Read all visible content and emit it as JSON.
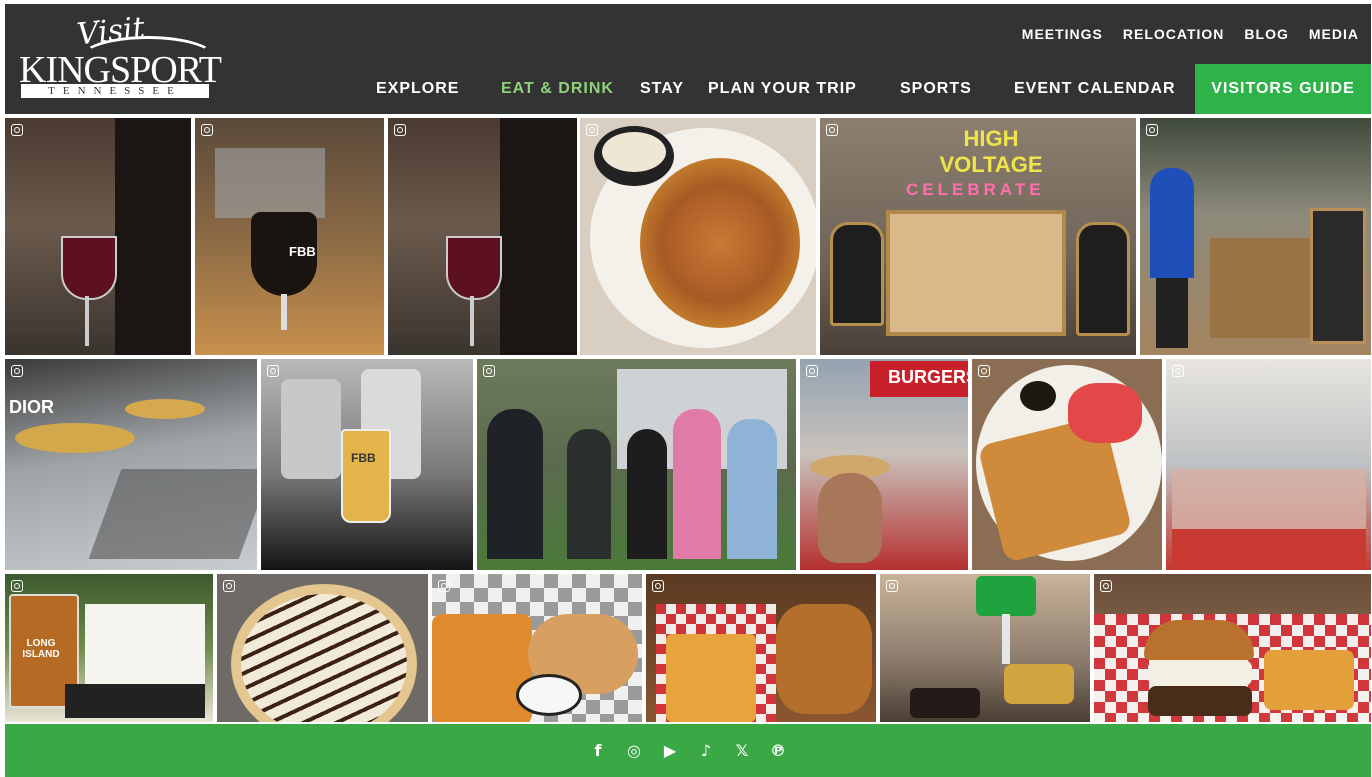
{
  "logo": {
    "visit": "Visit",
    "brand": "KINGSPORT",
    "state": "TENNESSEE"
  },
  "topnav": [
    "MEETINGS",
    "RELOCATION",
    "BLOG",
    "MEDIA"
  ],
  "mainnav": {
    "explore": "EXPLORE",
    "eat_drink": "EAT & DRINK",
    "stay": "STAY",
    "plan": "PLAN YOUR TRIP",
    "sports": "SPORTS",
    "events": "EVENT CALENDAR",
    "guide": "VISITORS GUIDE"
  },
  "photo_text": {
    "fbb": "FBB",
    "high_voltage": "HIGH VOLTAGE",
    "celebrate": "CELEBRATE",
    "dior": "DIOR",
    "burgers": "BURGERS",
    "long_island": "LONG ISLAND"
  },
  "footer": {
    "icons": [
      "facebook-icon",
      "instagram-icon",
      "youtube-icon",
      "tiktok-icon",
      "x-icon",
      "pinterest-icon"
    ],
    "glyphs": [
      "f",
      "◎",
      "▶",
      "♪",
      "𝕏",
      "℗"
    ]
  },
  "colors": {
    "header": "#333333",
    "accent": "#2fb24a",
    "active_nav": "#8fd17a"
  }
}
